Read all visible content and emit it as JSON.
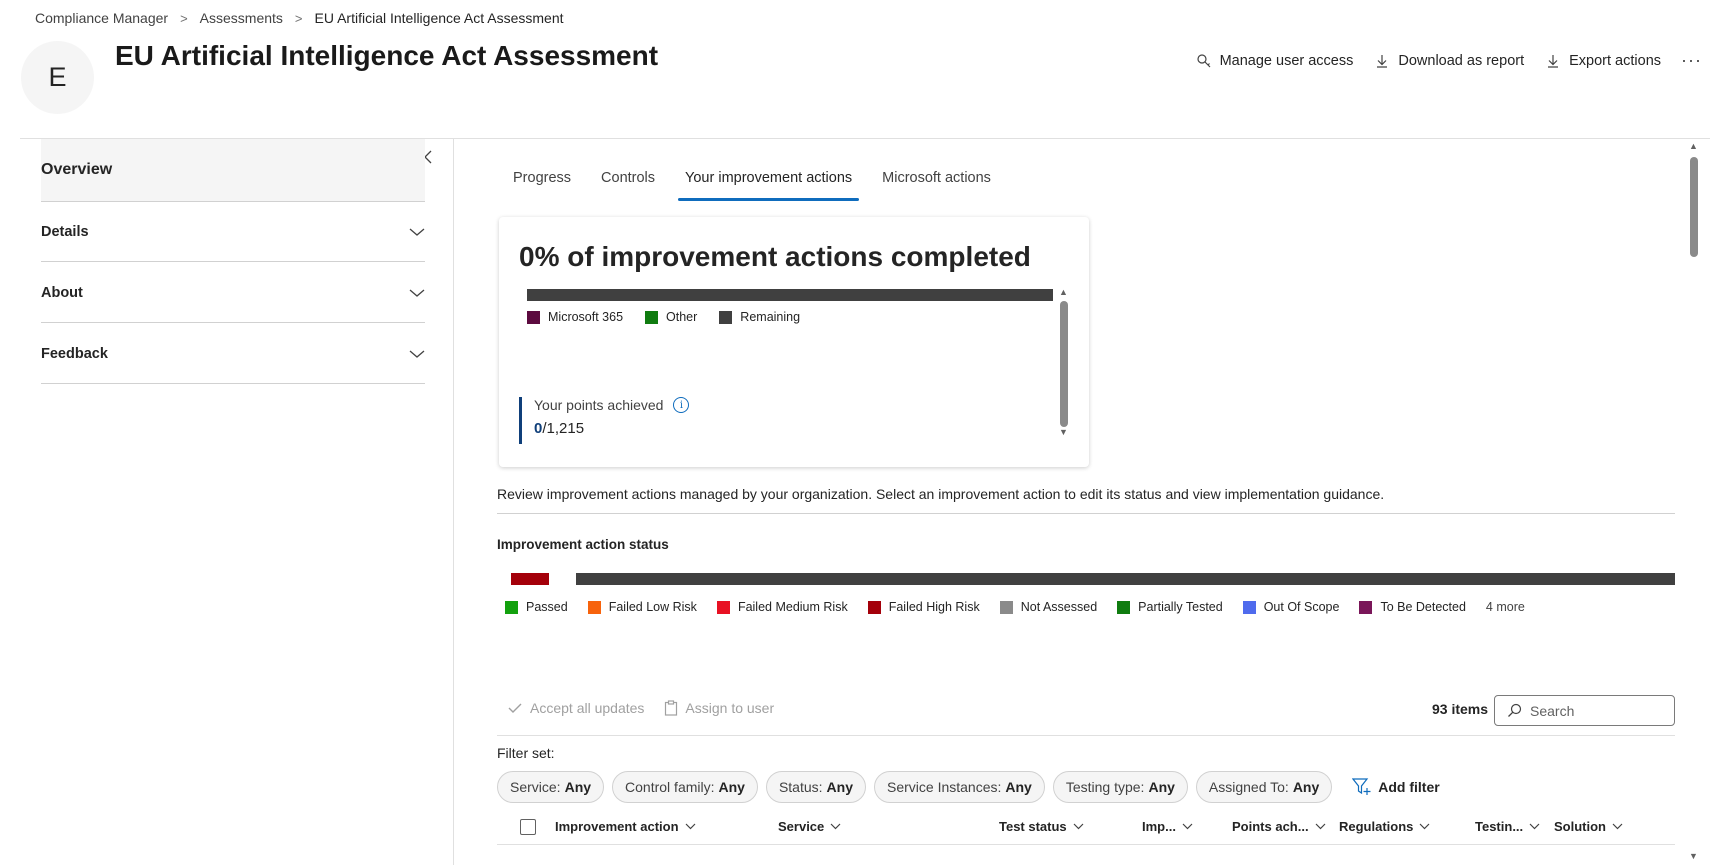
{
  "breadcrumb": {
    "items": [
      "Compliance Manager",
      "Assessments",
      "EU Artificial Intelligence Act Assessment"
    ],
    "separator": ">"
  },
  "header": {
    "avatar_letter": "E",
    "title": "EU Artificial Intelligence Act Assessment",
    "actions": {
      "manage_access": "Manage user access",
      "download_report": "Download as report",
      "export_actions": "Export actions",
      "more": "···"
    }
  },
  "sidebar": {
    "overview": "Overview",
    "items": [
      {
        "label": "Details"
      },
      {
        "label": "About"
      },
      {
        "label": "Feedback"
      }
    ]
  },
  "tabs": [
    {
      "label": "Progress",
      "active": false
    },
    {
      "label": "Controls",
      "active": false
    },
    {
      "label": "Your improvement actions",
      "active": true
    },
    {
      "label": "Microsoft actions",
      "active": false
    }
  ],
  "summary_card": {
    "title": "0% of improvement actions completed",
    "progress_completed_fraction": 0,
    "legend": [
      {
        "label": "Microsoft 365",
        "color": "#5c0a3f"
      },
      {
        "label": "Other",
        "color": "#107c10"
      },
      {
        "label": "Remaining",
        "color": "#404040"
      }
    ],
    "points_label": "Your points achieved",
    "points_achieved": "0",
    "points_total": "/1,215"
  },
  "description": "Review improvement actions managed by your organization. Select an improvement action to edit its status and view implementation guidance.",
  "status_section": {
    "title": "Improvement action status",
    "legend": [
      {
        "label": "Passed",
        "color": "#13a10e"
      },
      {
        "label": "Failed Low Risk",
        "color": "#f7630c"
      },
      {
        "label": "Failed Medium Risk",
        "color": "#e81123"
      },
      {
        "label": "Failed High Risk",
        "color": "#a4000a"
      },
      {
        "label": "Not Assessed",
        "color": "#8a8a8a"
      },
      {
        "label": "Partially Tested",
        "color": "#107c10"
      },
      {
        "label": "Out Of Scope",
        "color": "#4f6bed"
      },
      {
        "label": "To Be Detected",
        "color": "#7a1659"
      }
    ],
    "more": "4 more",
    "colors": {
      "failed_high": "#a4000a",
      "remaining": "#404040"
    }
  },
  "toolbar": {
    "accept_updates": "Accept all updates",
    "assign_user": "Assign to user",
    "items_count": "93 items",
    "search_placeholder": "Search"
  },
  "filters": {
    "label": "Filter set:",
    "pills": [
      {
        "name": "Service:",
        "value": "Any"
      },
      {
        "name": "Control family:",
        "value": "Any"
      },
      {
        "name": "Status:",
        "value": "Any"
      },
      {
        "name": "Service Instances:",
        "value": "Any"
      },
      {
        "name": "Testing type:",
        "value": "Any"
      },
      {
        "name": "Assigned To:",
        "value": "Any"
      }
    ],
    "add_filter": "Add filter"
  },
  "table": {
    "columns": [
      "Improvement action",
      "Service",
      "Test status",
      "Imp...",
      "Points ach...",
      "Regulations",
      "Testin...",
      "Solution"
    ]
  },
  "icons": {
    "key": "key-icon",
    "download": "download-icon",
    "export": "export-icon",
    "chevron": "chevron-down-icon",
    "collapse": "chevron-left-icon",
    "info": "info-icon",
    "check": "check-icon",
    "clipboard": "clipboard-icon",
    "search": "search-icon",
    "filter": "filter-add-icon"
  }
}
